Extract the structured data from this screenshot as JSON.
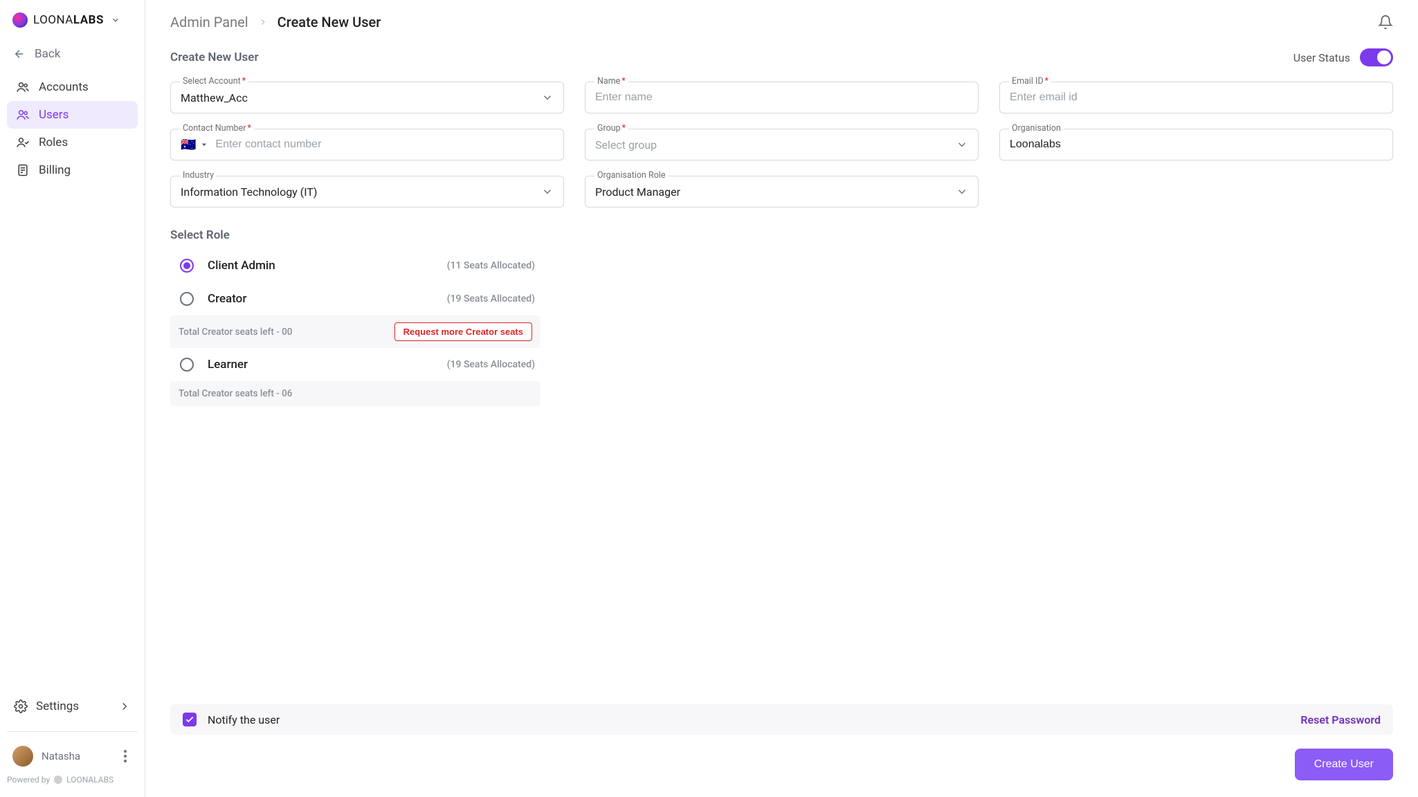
{
  "brand": {
    "name_light": "LOONA",
    "name_bold": "LABS"
  },
  "sidebar": {
    "back": "Back",
    "items": [
      {
        "label": "Accounts"
      },
      {
        "label": "Users"
      },
      {
        "label": "Roles"
      },
      {
        "label": "Billing"
      }
    ],
    "settings": "Settings"
  },
  "user": {
    "name": "Natasha"
  },
  "powered_prefix": "Powered by",
  "powered_brand": "LOONALABS",
  "breadcrumb": {
    "parent": "Admin Panel",
    "current": "Create New User"
  },
  "page_title": "Create New User",
  "status": {
    "label": "User Status"
  },
  "fields": {
    "account": {
      "label": "Select Account",
      "value": "Matthew_Acc"
    },
    "name": {
      "label": "Name",
      "placeholder": "Enter name"
    },
    "email": {
      "label": "Email ID",
      "placeholder": "Enter email id"
    },
    "contact": {
      "label": "Contact Number",
      "placeholder": "Enter contact number",
      "flag": "🇦🇺"
    },
    "group": {
      "label": "Group",
      "placeholder": "Select group"
    },
    "org": {
      "label": "Organisation",
      "value": "Loonalabs"
    },
    "industry": {
      "label": "Industry",
      "value": "Information Technology (IT)"
    },
    "org_role": {
      "label": "Organisation Role",
      "value": "Product Manager"
    }
  },
  "roles": {
    "title": "Select Role",
    "items": [
      {
        "name": "Client Admin",
        "seats": "(11 Seats Allocated)",
        "selected": true
      },
      {
        "name": "Creator",
        "seats": "(19 Seats Allocated)",
        "selected": false,
        "note": "Total Creator seats left - 00",
        "request": "Request more Creator seats"
      },
      {
        "name": "Learner",
        "seats": "(19 Seats Allocated)",
        "selected": false,
        "note": "Total Creator seats left - 06"
      }
    ]
  },
  "footer": {
    "notify": "Notify the user",
    "reset": "Reset Password",
    "create": "Create User"
  }
}
